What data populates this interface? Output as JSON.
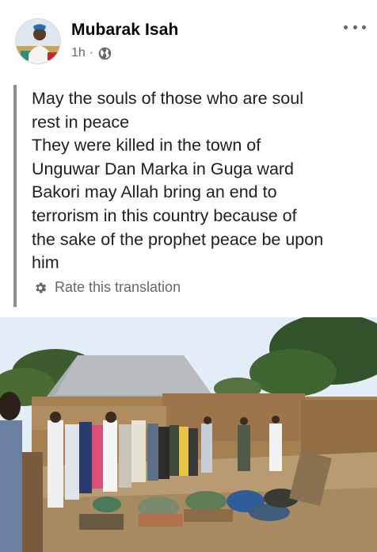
{
  "post": {
    "author": "Mubarak Isah",
    "time": "1h",
    "separator": "·",
    "audience_icon": "globe-icon",
    "more_icon": "more-options-icon",
    "translated_text": "May the souls of those who are soul\nrest in peace\nThey were killed in the town of\nUnguwar Dan Marka in Guga ward\nBakori may Allah bring an end to\nterrorism in this country because of\nthe sake of the prophet peace be upon\nhim",
    "rate_translation_label": "Rate this translation",
    "rate_icon": "gear-icon"
  },
  "colors": {
    "text": "#050505",
    "secondary_text": "#65676b",
    "quote_bar": "#8a8d91"
  }
}
